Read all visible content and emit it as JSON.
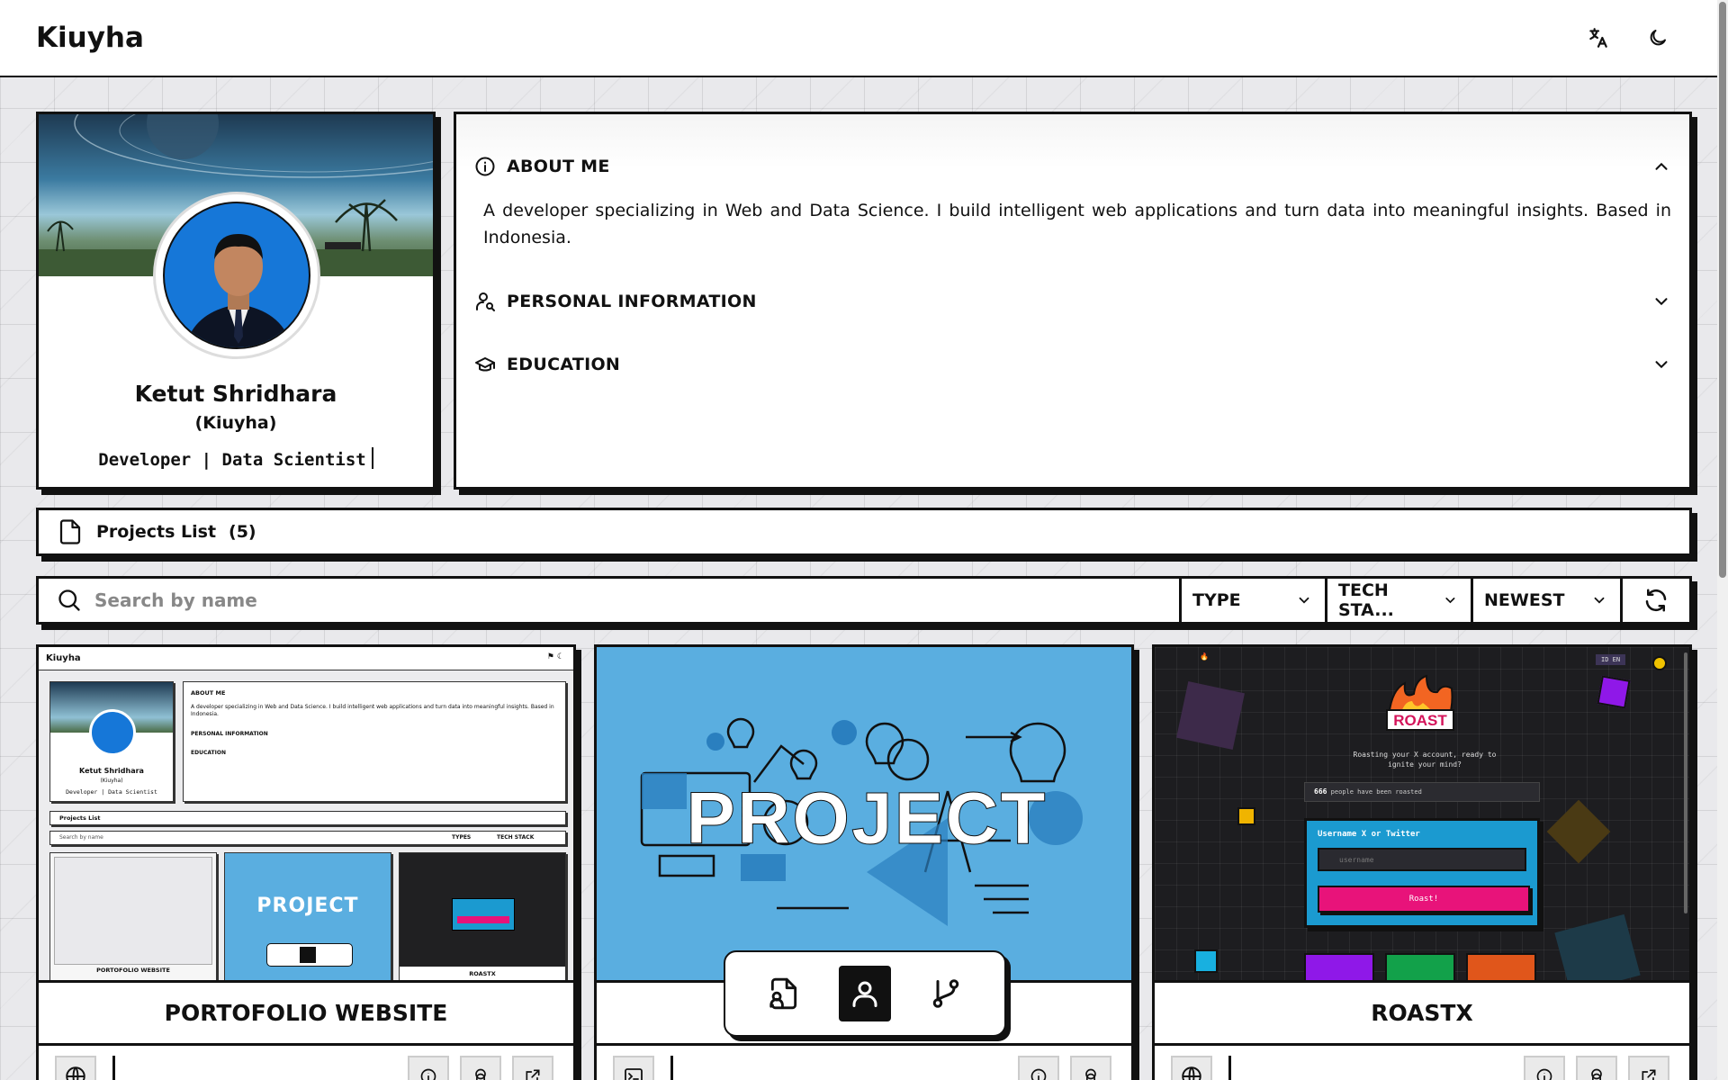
{
  "app": {
    "brand": "Kiuyha"
  },
  "topbar": {
    "translate_icon": "translate-icon",
    "theme_icon": "moon-icon"
  },
  "profile": {
    "name": "Ketut Shridhara",
    "nickname": "(Kiuyha)",
    "role": "Developer | Data Scientist"
  },
  "about": {
    "sections": [
      {
        "title": "ABOUT ME",
        "icon": "info-icon",
        "expanded": true,
        "body": "A developer specializing in Web and Data Science. I build intelligent web applications and turn data into meaningful insights. Based in Indonesia."
      },
      {
        "title": "PERSONAL INFORMATION",
        "icon": "user-search-icon",
        "expanded": false
      },
      {
        "title": "EDUCATION",
        "icon": "graduation-cap-icon",
        "expanded": false
      }
    ]
  },
  "projects": {
    "header": "Projects List",
    "count": "(5)",
    "search_placeholder": "Search by name",
    "filters": {
      "type": "TYPE",
      "tech": "TECH STA...",
      "sort": "NEWEST"
    },
    "cards": [
      {
        "title": "PORTOFOLIO WEBSITE"
      },
      {
        "title": "",
        "thumb_text": "PROJECT"
      },
      {
        "title": "ROASTX"
      }
    ]
  },
  "mini": {
    "brand": "Kiuyha",
    "about": "ABOUT ME",
    "about_body": "A developer specializing in Web and Data Science. I build intelligent web applications and turn data into meaningful insights. Based in Indonesia.",
    "personal": "PERSONAL INFORMATION",
    "education": "EDUCATION",
    "name": "Ketut Shridhara",
    "nick": "(Kiuyha)",
    "role": "Developer | Data Scientist",
    "projects": "Projects List",
    "search": "Search by name",
    "types": "TYPES",
    "tech": "TECH STACK",
    "card1": "PORTOFOLIO WEBSITE",
    "card3": "ROASTX",
    "project": "PROJECT"
  },
  "roastx": {
    "lang": "ID EN",
    "tagline": "Roasting your X account, ready to ignite your mind?",
    "count": "666",
    "count_label": "people have been roasted",
    "input_label": "Username X or Twitter",
    "input_placeholder": "username",
    "button": "Roast!"
  },
  "colors": {
    "accent": "#111111",
    "project_bg": "#5aaee0",
    "roast_pink": "#e8137a",
    "roast_cyan": "#1b9ad0"
  }
}
